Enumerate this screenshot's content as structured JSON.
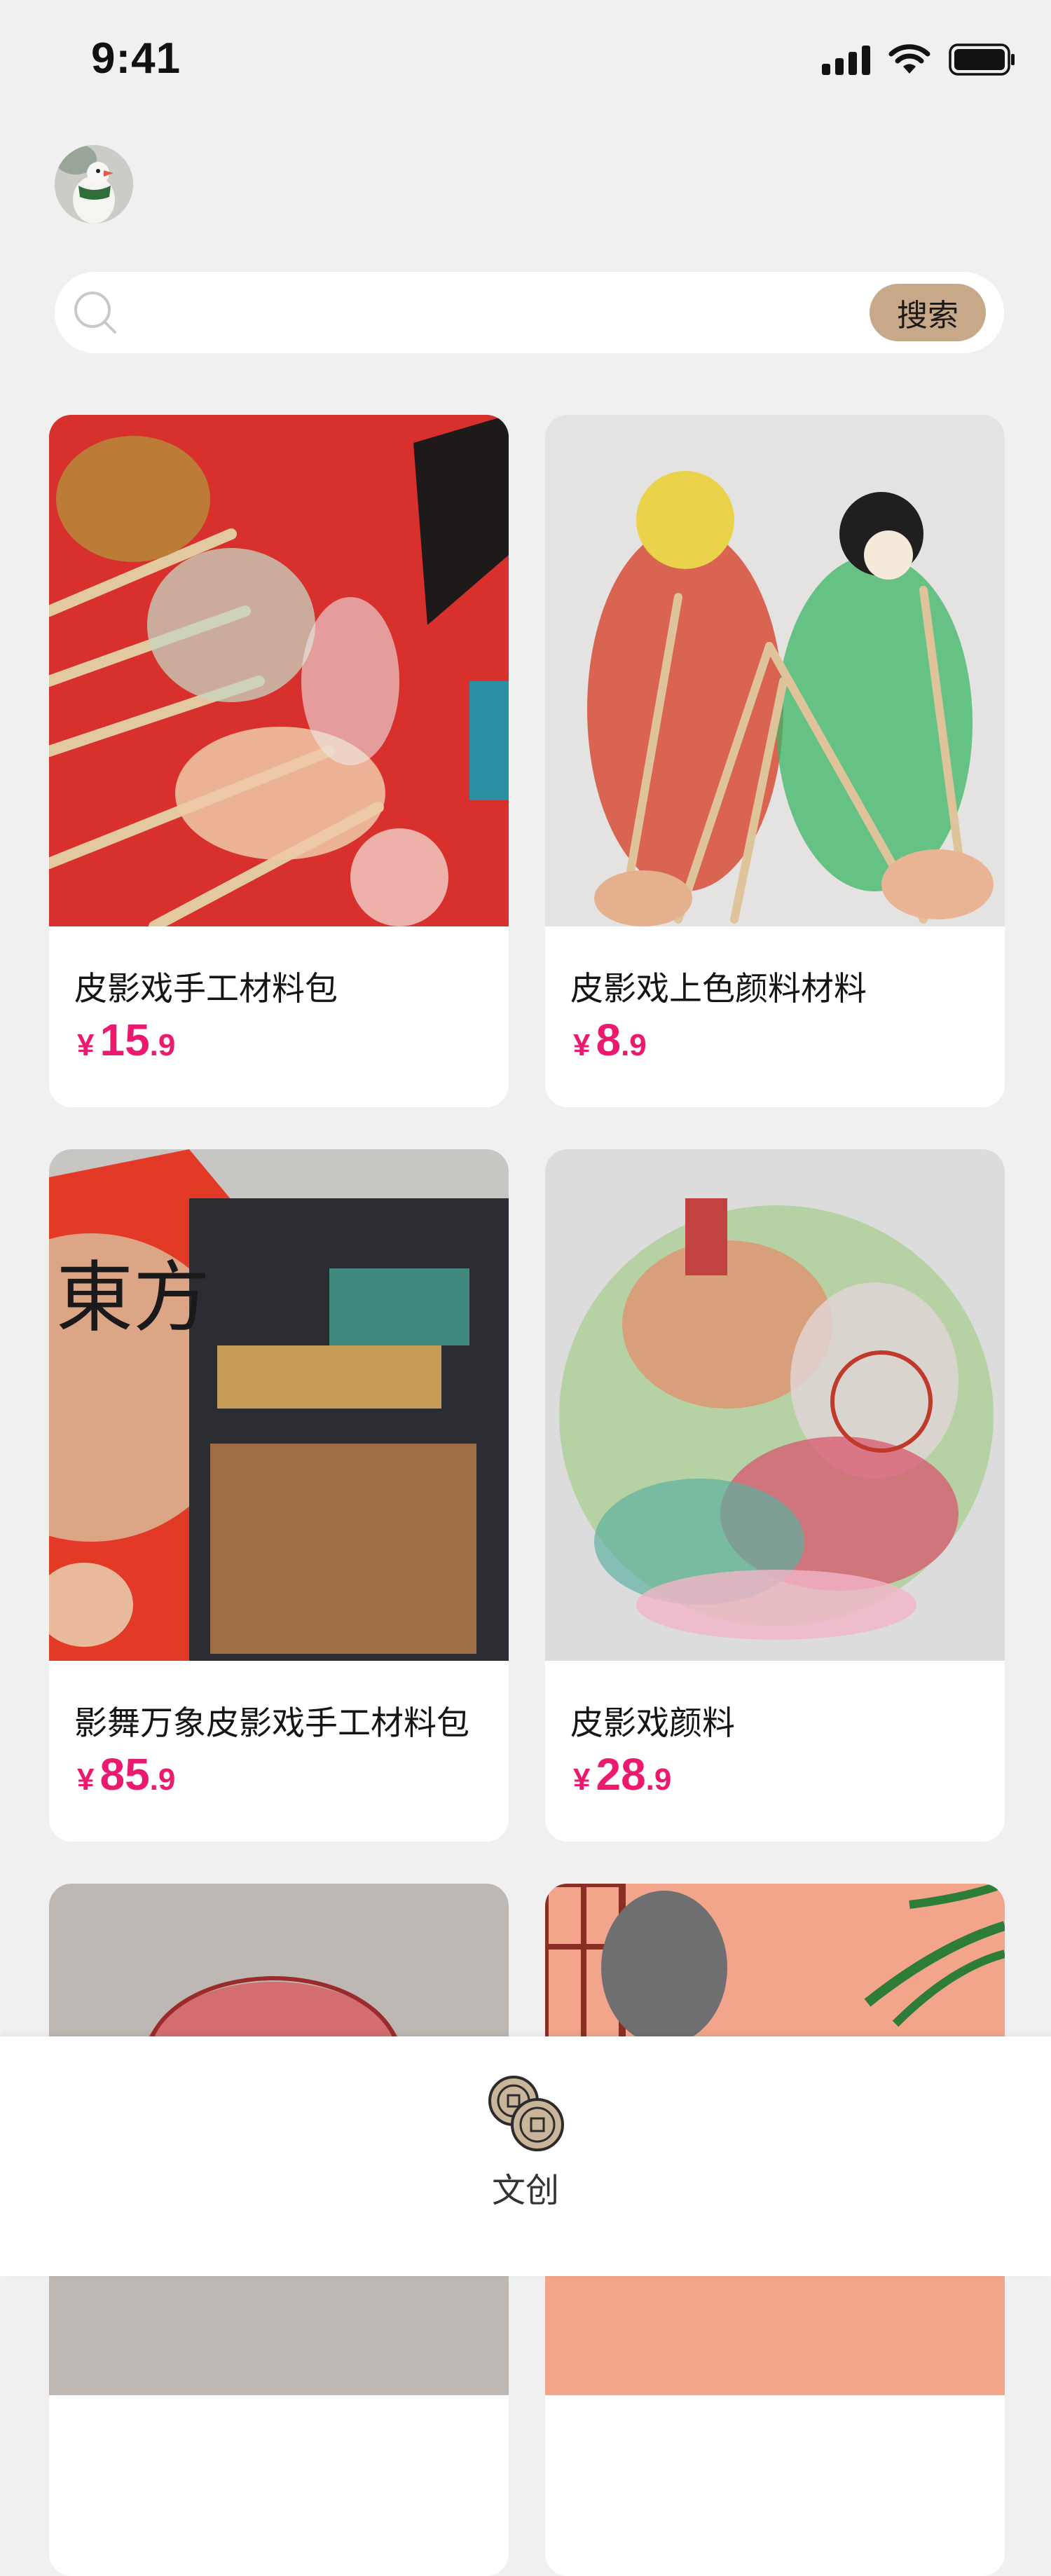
{
  "status_bar": {
    "time": "9:41",
    "icons": [
      "signal-icon",
      "wifi-icon",
      "battery-icon"
    ]
  },
  "header": {
    "avatar": "user-avatar"
  },
  "search": {
    "placeholder": "",
    "button_label": "搜索"
  },
  "products": [
    {
      "title": "皮影戏手工材料包",
      "currency": "¥",
      "price_int": "15",
      "price_dec": ".9"
    },
    {
      "title": "皮影戏上色颜料材料",
      "currency": "¥",
      "price_int": "8",
      "price_dec": ".9"
    },
    {
      "title": "影舞万象皮影戏手工材料包",
      "currency": "¥",
      "price_int": "85",
      "price_dec": ".9"
    },
    {
      "title": "皮影戏颜料",
      "currency": "¥",
      "price_int": "28",
      "price_dec": ".9"
    },
    {
      "title": "",
      "currency": "",
      "price_int": "",
      "price_dec": ""
    },
    {
      "title": "",
      "currency": "",
      "price_int": "",
      "price_dec": ""
    }
  ],
  "image_texts": {
    "product3_box": "東方"
  },
  "tab_bar": {
    "items": [
      {
        "label": "文创",
        "icon": "coins-icon",
        "active": true
      }
    ]
  },
  "colors": {
    "price": "#ec1a6f",
    "search_button": "#c7a889",
    "background": "#f1f0f0"
  }
}
